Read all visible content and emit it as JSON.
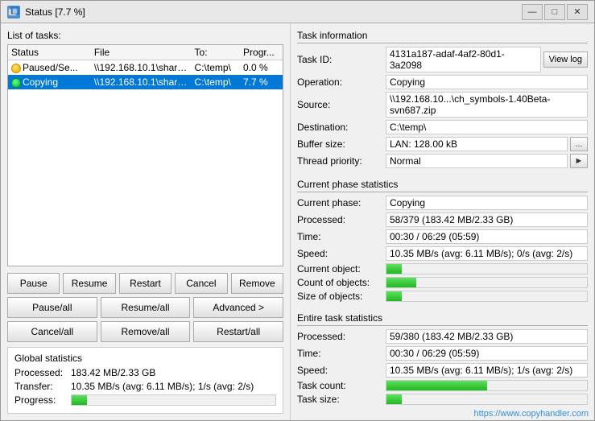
{
  "window": {
    "title": "Status [7.7 %]",
    "icon": "S"
  },
  "left": {
    "tasks_label": "List of tasks:",
    "table_headers": [
      "Status",
      "File",
      "To:",
      "Progr..."
    ],
    "tasks": [
      {
        "status": "Paused/Se...",
        "status_type": "yellow",
        "file": "\\\\192.168.10.1\\share...",
        "to": "C:\\temp\\",
        "progress": "0.0 %",
        "progress_val": 0
      },
      {
        "status": "Copying",
        "status_type": "green",
        "file": "\\\\192.168.10.1\\share...",
        "to": "C:\\temp\\",
        "progress": "7.7 %",
        "progress_val": 7.7,
        "selected": true
      }
    ],
    "buttons_row1": [
      "Pause",
      "Resume",
      "Restart",
      "Cancel",
      "Remove"
    ],
    "buttons_row2": [
      "Pause/all",
      "Resume/all",
      "Advanced >"
    ],
    "buttons_row3": [
      "Cancel/all",
      "Remove/all",
      "Restart/all"
    ],
    "global_stats": {
      "title": "Global statistics",
      "rows": [
        {
          "label": "Processed:",
          "value": "183.42 MB/2.33 GB"
        },
        {
          "label": "Transfer:",
          "value": "10.35 MB/s (avg: 6.11 MB/s); 1/s (avg: 2/s)"
        },
        {
          "label": "Progress:",
          "value": "",
          "is_progress": true,
          "progress_val": 7.7
        }
      ]
    }
  },
  "right": {
    "task_info": {
      "title": "Task information",
      "rows": [
        {
          "label": "Task ID:",
          "value": "4131a187-adaf-4af2-80d1-3a2098",
          "has_view_log": true
        },
        {
          "label": "Operation:",
          "value": "Copying"
        },
        {
          "label": "Source:",
          "value": "\\\\192.168.10...\\ch_symbols-1.40Beta-svn687.zip"
        },
        {
          "label": "Destination:",
          "value": "C:\\temp\\"
        },
        {
          "label": "Buffer size:",
          "value": "LAN: 128.00 kB",
          "has_dots_btn": true
        },
        {
          "label": "Thread priority:",
          "value": "Normal",
          "has_arrow_btn": true
        }
      ]
    },
    "current_phase": {
      "title": "Current phase statistics",
      "rows": [
        {
          "label": "Current phase:",
          "value": "Copying"
        },
        {
          "label": "Processed:",
          "value": "58/379 (183.42 MB/2.33 GB)"
        },
        {
          "label": "Time:",
          "value": "00:30 / 06:29 (05:59)"
        },
        {
          "label": "Speed:",
          "value": "10.35 MB/s (avg: 6.11 MB/s); 0/s (avg: 2/s)"
        },
        {
          "label": "Current object:",
          "value": "",
          "is_progress": true,
          "progress_val": 7.7
        },
        {
          "label": "Count of objects:",
          "value": "",
          "is_progress": true,
          "progress_val": 15
        },
        {
          "label": "Size of objects:",
          "value": "",
          "is_progress": true,
          "progress_val": 7.7
        }
      ]
    },
    "entire_task": {
      "title": "Entire task statistics",
      "rows": [
        {
          "label": "Processed:",
          "value": "59/380 (183.42 MB/2.33 GB)"
        },
        {
          "label": "Time:",
          "value": "00:30 / 06:29 (05:59)"
        },
        {
          "label": "Speed:",
          "value": "10.35 MB/s (avg: 6.11 MB/s); 1/s (avg: 2/s)"
        },
        {
          "label": "Task count:",
          "value": "",
          "is_progress": true,
          "progress_val": 50
        },
        {
          "label": "Task size:",
          "value": "",
          "is_progress": true,
          "progress_val": 7.7
        }
      ]
    }
  },
  "watermark": "https://www.copyhandler.com"
}
